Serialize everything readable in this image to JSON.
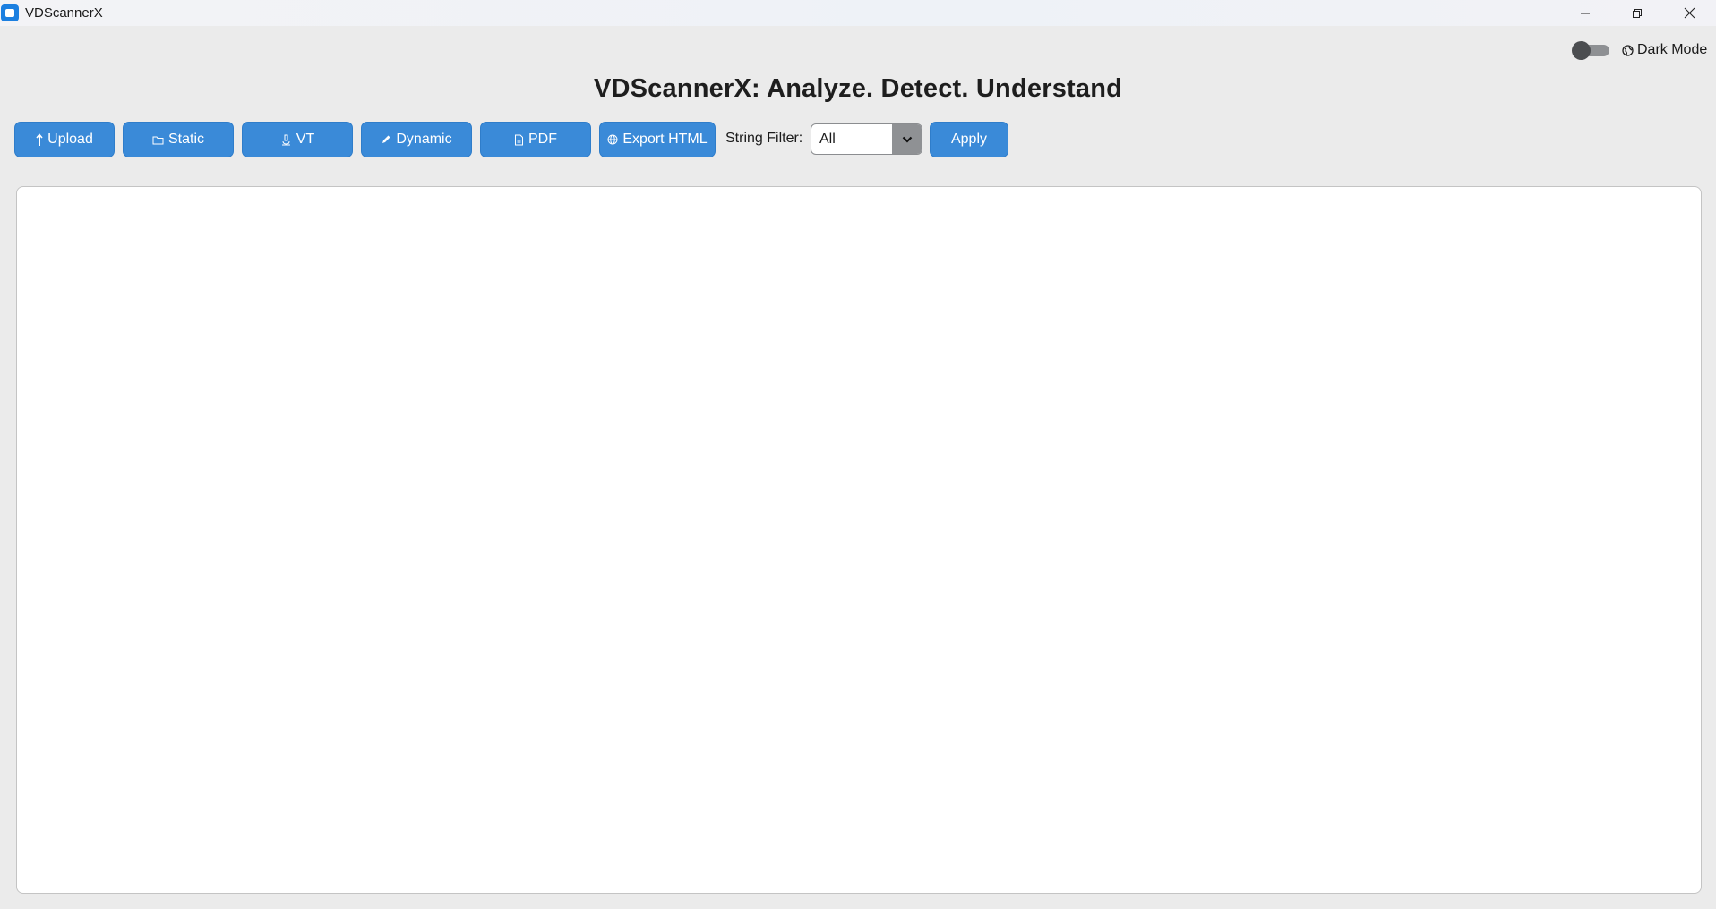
{
  "window": {
    "title": "VDScannerX",
    "controls": {
      "minimize": "minimize-icon",
      "maximize": "restore-icon",
      "close": "close-icon"
    }
  },
  "dark_mode": {
    "label": "Dark Mode",
    "enabled": false,
    "icon": "globe-icon"
  },
  "header": {
    "title": "VDScannerX: Analyze. Detect. Understand"
  },
  "toolbar": {
    "upload_label": "Upload",
    "static_label": "Static",
    "vt_label": "VT",
    "dynamic_label": "Dynamic",
    "pdf_label": "PDF",
    "export_label": "Export HTML",
    "filter_label": "String Filter:",
    "filter_value": "All",
    "apply_label": "Apply"
  },
  "colors": {
    "button": "#3a8ad8",
    "background": "#ebebeb",
    "panel": "#ffffff"
  }
}
